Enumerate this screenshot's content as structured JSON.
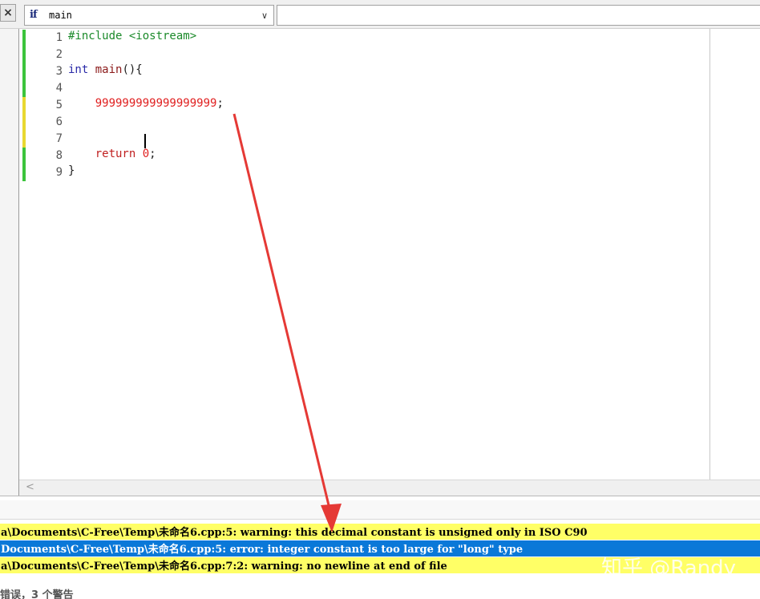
{
  "toolbar": {
    "close_label": "×",
    "function_icon": "if",
    "function_name": "main",
    "combo_arrow": "∨"
  },
  "editor": {
    "lines": [
      {
        "num": "1",
        "tokens": [
          {
            "t": "#include <iostream>",
            "c": "pp"
          }
        ]
      },
      {
        "num": "2",
        "tokens": []
      },
      {
        "num": "3",
        "tokens": [
          {
            "t": "int",
            "c": "kw"
          },
          {
            "t": " ",
            "c": "punc"
          },
          {
            "t": "main",
            "c": "fn"
          },
          {
            "t": "(){",
            "c": "punc"
          }
        ]
      },
      {
        "num": "4",
        "tokens": []
      },
      {
        "num": "5",
        "tokens": [
          {
            "t": "    999999999999999999",
            "c": "num"
          },
          {
            "t": ";",
            "c": "punc"
          }
        ]
      },
      {
        "num": "6",
        "tokens": []
      },
      {
        "num": "7",
        "tokens": []
      },
      {
        "num": "8",
        "tokens": [
          {
            "t": "    return ",
            "c": "ret"
          },
          {
            "t": "0",
            "c": "num"
          },
          {
            "t": ";",
            "c": "punc"
          }
        ]
      },
      {
        "num": "9",
        "tokens": [
          {
            "t": "}",
            "c": "punc"
          }
        ]
      }
    ],
    "change_markers": [
      "#3cc43c",
      "#3cc43c",
      "#3cc43c",
      "#3cc43c",
      "#e8d830",
      "#e8d830",
      "#e8d830",
      "#3cc43c",
      "#3cc43c"
    ]
  },
  "scroll": {
    "left_arrow": "<"
  },
  "messages": [
    {
      "type": "warning",
      "text": "a\\Documents\\C-Free\\Temp\\未命名6.cpp:5: warning: this decimal constant is unsigned only in ISO C90"
    },
    {
      "type": "error",
      "text": "Documents\\C-Free\\Temp\\未命名6.cpp:5: error: integer constant is too large for \"long\" type"
    },
    {
      "type": "warning",
      "text": "a\\Documents\\C-Free\\Temp\\未命名6.cpp:7:2: warning: no newline at end of file"
    }
  ],
  "status": {
    "text": "错误，3 个警告"
  },
  "watermark": {
    "text": "知乎 @Randy"
  },
  "colors": {
    "warning_bg": "#ffff66",
    "error_bg": "#0a78d8",
    "annotation_arrow": "#e53935"
  }
}
